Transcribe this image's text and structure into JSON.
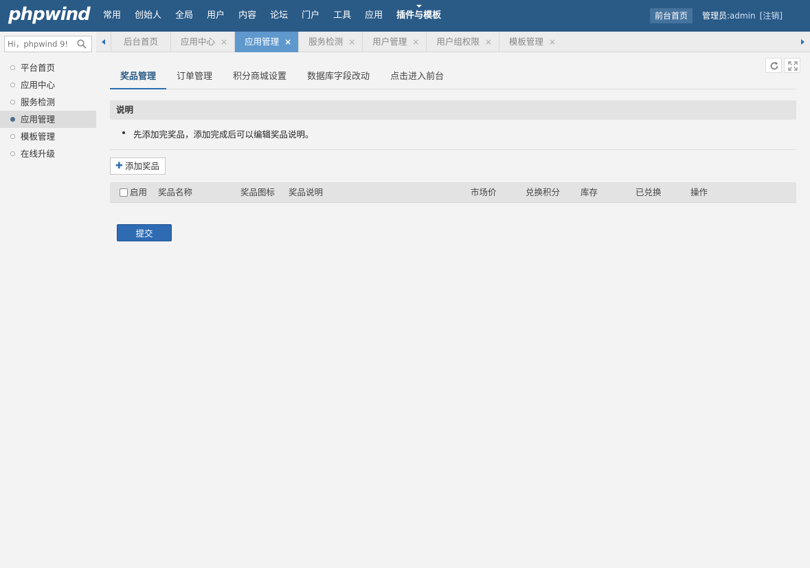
{
  "brand": {
    "logo_text": "phpwind"
  },
  "topnav": {
    "items": [
      "常用",
      "创始人",
      "全局",
      "用户",
      "内容",
      "论坛",
      "门户",
      "工具",
      "应用",
      "插件与模板"
    ],
    "active": "插件与模板"
  },
  "header": {
    "front_label": "前台首页",
    "admin_label": "管理员:",
    "admin_name": "admin",
    "logout_label": "[注销]"
  },
  "search": {
    "placeholder": "Hi，phpwind 9!"
  },
  "sidebar": {
    "items": [
      {
        "label": "平台首页"
      },
      {
        "label": "应用中心"
      },
      {
        "label": "服务检测"
      },
      {
        "label": "应用管理",
        "active": true
      },
      {
        "label": "模板管理"
      },
      {
        "label": "在线升级"
      }
    ]
  },
  "page_tabs": [
    {
      "label": "后台首页",
      "closable": false
    },
    {
      "label": "应用中心",
      "closable": true
    },
    {
      "label": "应用管理",
      "closable": true,
      "active": true
    },
    {
      "label": "服务检测",
      "closable": true
    },
    {
      "label": "用户管理",
      "closable": true
    },
    {
      "label": "用户组权限",
      "closable": true
    },
    {
      "label": "模板管理",
      "closable": true
    }
  ],
  "tab_close_glyph": "×",
  "subnav": {
    "items": [
      "奖品管理",
      "订单管理",
      "积分商城设置",
      "数据库字段改动",
      "点击进入前台"
    ],
    "active": "奖品管理"
  },
  "note": {
    "title": "说明",
    "items": [
      "先添加完奖品，添加完成后可以编辑奖品说明。"
    ]
  },
  "add_button": {
    "plus": "✚",
    "label": "添加奖品"
  },
  "table": {
    "enable_label": "启用",
    "columns": [
      "奖品名称",
      "奖品图标",
      "奖品说明",
      "市场价",
      "兑换积分",
      "库存",
      "已兑换",
      "操作"
    ]
  },
  "submit_label": "提交",
  "colors": {
    "topbar": "#2a5a86",
    "active_tab": "#5f98cd",
    "submit": "#2e6bb3"
  }
}
